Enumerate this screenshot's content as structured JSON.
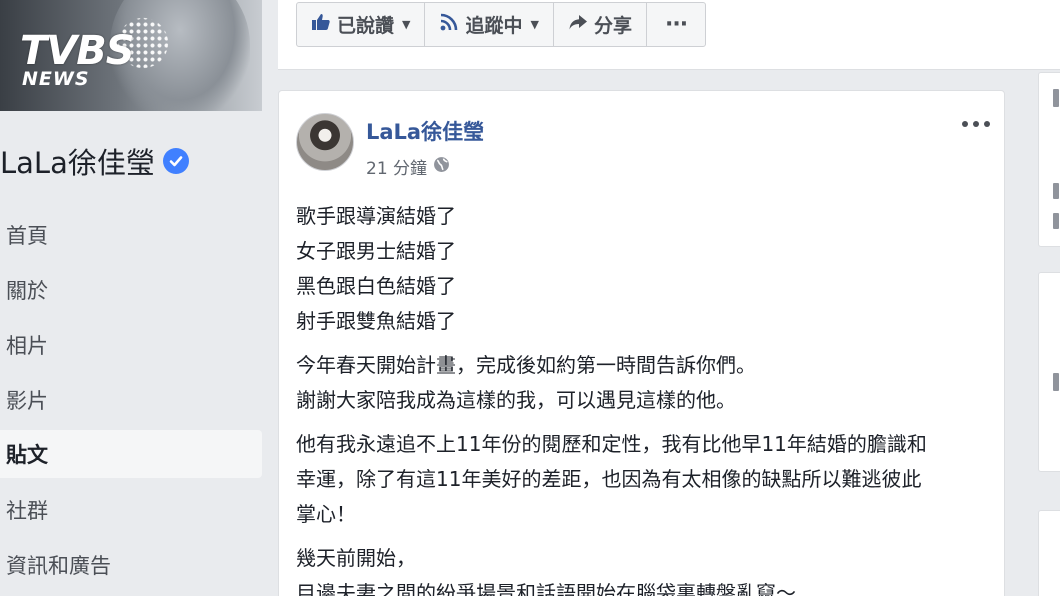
{
  "cover": {
    "logo_primary": "TVBS",
    "logo_secondary": "NEWS"
  },
  "page": {
    "name": "LaLa徐佳瑩",
    "verified": true
  },
  "nav": {
    "items": [
      {
        "label": "首頁",
        "active": false
      },
      {
        "label": "關於",
        "active": false
      },
      {
        "label": "相片",
        "active": false
      },
      {
        "label": "影片",
        "active": false
      },
      {
        "label": "貼文",
        "active": true
      },
      {
        "label": "社群",
        "active": false
      },
      {
        "label": "資訊和廣告",
        "active": false
      }
    ]
  },
  "toolbar": {
    "liked_label": "已說讚",
    "following_label": "追蹤中",
    "share_label": "分享",
    "more_label": "···"
  },
  "post": {
    "author": "LaLa徐佳瑩",
    "time": "21 分鐘",
    "privacy_icon": "globe-icon",
    "paragraphs": [
      [
        "歌手跟導演結婚了",
        "女子跟男士結婚了",
        "黑色跟白色結婚了",
        "射手跟雙魚結婚了"
      ],
      [
        "今年春天開始計畫，完成後如約第一時間告訴你們。",
        "謝謝大家陪我成為這樣的我，可以遇見這樣的他。"
      ],
      [
        "他有我永遠追不上11年份的閱歷和定性，我有比他早11年結婚的膽識和",
        "幸運，除了有這11年美好的差距，也因為有太相像的缺點所以難逃彼此",
        "掌心！"
      ],
      [
        "幾天前開始，",
        "目邊夫妻之間的紛爭場景和話語開始在腦袋裏轉盤亂竄～"
      ]
    ]
  },
  "colors": {
    "link": "#365899",
    "verified": "#4080ff",
    "background": "#e9ebee"
  }
}
